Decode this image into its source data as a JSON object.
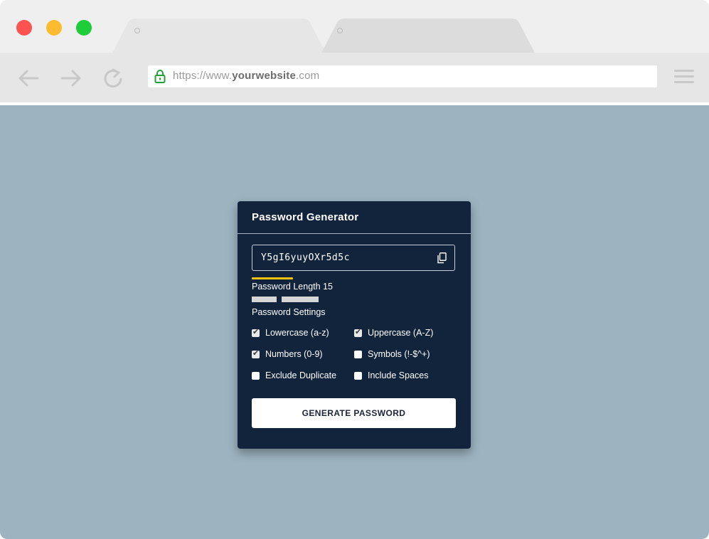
{
  "browser": {
    "url_prefix": "https://www.",
    "url_domain": "yourwebsite",
    "url_suffix": ".com"
  },
  "generator": {
    "title": "Password Generator",
    "password_value": "Y5gI6yuyOXr5d5c",
    "length_label": "Password Length 15",
    "settings_label": "Password Settings",
    "options": [
      {
        "label": "Lowercase (a-z)",
        "checked": true
      },
      {
        "label": "Uppercase (A-Z)",
        "checked": true
      },
      {
        "label": "Numbers (0-9)",
        "checked": true
      },
      {
        "label": "Symbols (!-$^+)",
        "checked": false
      },
      {
        "label": "Exclude Duplicate",
        "checked": false
      },
      {
        "label": "Include Spaces",
        "checked": false
      }
    ],
    "generate_label": "GENERATE PASSWORD"
  },
  "colors": {
    "page_bg": "#9db4c0",
    "card_bg": "#12233c",
    "strength_bar": "#f6c20b",
    "traffic_red": "#fe5350",
    "traffic_yellow": "#fdbb2f",
    "traffic_green": "#1fcd3a",
    "lock_green": "#22a03a"
  },
  "icons": {
    "copy": "copy-icon",
    "lock": "lock-icon",
    "back": "back-arrow-icon",
    "forward": "forward-arrow-icon",
    "reload": "reload-icon",
    "menu": "hamburger-menu-icon"
  }
}
